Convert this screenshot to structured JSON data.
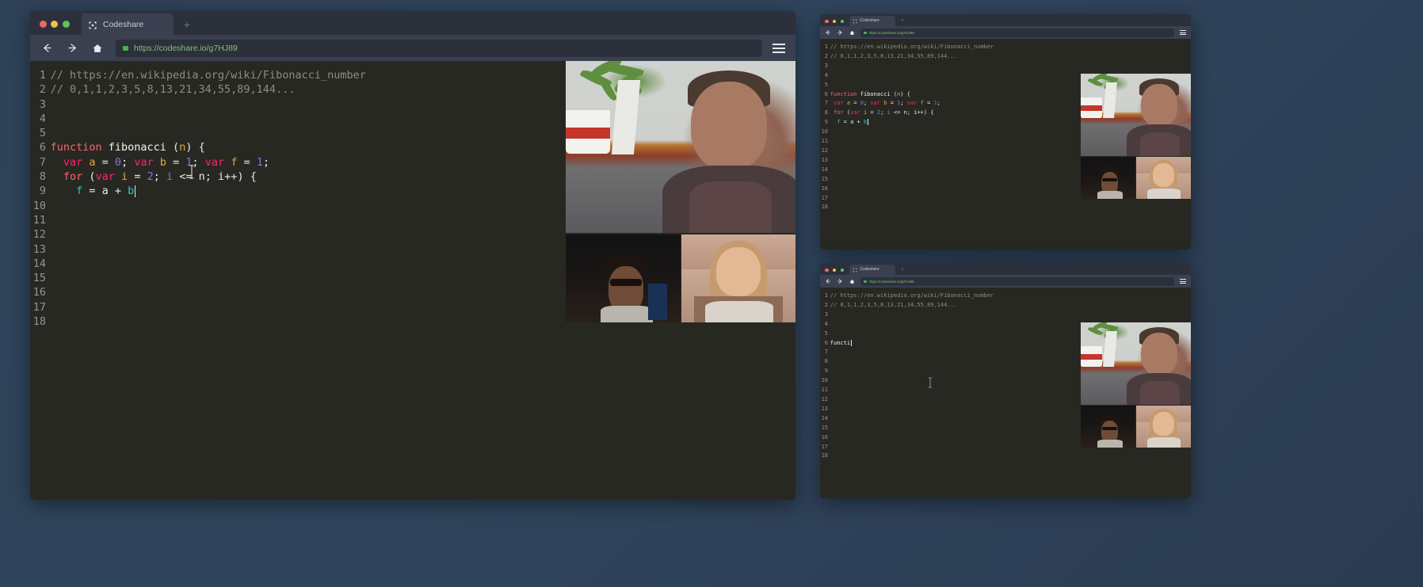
{
  "app": {
    "name": "Codeshare"
  },
  "desktop": {
    "background_color": "#2f4259"
  },
  "browser": {
    "tab_title": "Codeshare",
    "new_tab_label": "+",
    "url": "https://codeshare.io/g7HJ89",
    "lock_icon": "lock-icon",
    "back_icon": "←",
    "forward_icon": "→",
    "home_icon": "⌂",
    "menu_icon": "hamburger-menu-icon",
    "traffic_lights": [
      "close-red",
      "minimize-yellow",
      "maximize-green"
    ],
    "logo_icon": "codeshare-logo-icon"
  },
  "editor_main": {
    "line_numbers": [
      "1",
      "2",
      "3",
      "4",
      "5",
      "6",
      "7",
      "8",
      "9",
      "10",
      "11",
      "12",
      "13",
      "14",
      "15",
      "16",
      "17",
      "18"
    ],
    "lines": [
      {
        "n": "1",
        "tokens": [
          {
            "t": "// https://en.wikipedia.org/wiki/Fibonacci_number",
            "c": "com"
          }
        ]
      },
      {
        "n": "2",
        "tokens": [
          {
            "t": "// 0,1,1,2,3,5,8,13,21,34,55,89,144...",
            "c": "com"
          }
        ]
      },
      {
        "n": "3",
        "tokens": []
      },
      {
        "n": "4",
        "tokens": []
      },
      {
        "n": "5",
        "tokens": []
      },
      {
        "n": "6",
        "tokens": [
          {
            "t": "function",
            "c": "kw"
          },
          {
            "t": " ",
            "c": "pl"
          },
          {
            "t": "fibonacci",
            "c": "fn"
          },
          {
            "t": " (",
            "c": "pl"
          },
          {
            "t": "n",
            "c": "id"
          },
          {
            "t": ") {",
            "c": "pl"
          }
        ]
      },
      {
        "n": "7",
        "tokens": [
          {
            "t": "  ",
            "c": "pl"
          },
          {
            "t": "var",
            "c": "var"
          },
          {
            "t": " ",
            "c": "pl"
          },
          {
            "t": "a",
            "c": "id"
          },
          {
            "t": " = ",
            "c": "op"
          },
          {
            "t": "0",
            "c": "num"
          },
          {
            "t": "; ",
            "c": "pl"
          },
          {
            "t": "var",
            "c": "var"
          },
          {
            "t": " ",
            "c": "pl"
          },
          {
            "t": "b",
            "c": "id"
          },
          {
            "t": " = ",
            "c": "op"
          },
          {
            "t": "1",
            "c": "num"
          },
          {
            "t": "; ",
            "c": "pl"
          },
          {
            "t": "var",
            "c": "var"
          },
          {
            "t": " ",
            "c": "pl"
          },
          {
            "t": "f",
            "c": "id"
          },
          {
            "t": " = ",
            "c": "op"
          },
          {
            "t": "1",
            "c": "num"
          },
          {
            "t": ";",
            "c": "pl"
          }
        ]
      },
      {
        "n": "8",
        "tokens": [
          {
            "t": "  ",
            "c": "pl"
          },
          {
            "t": "for",
            "c": "kw"
          },
          {
            "t": " (",
            "c": "pl"
          },
          {
            "t": "var",
            "c": "var"
          },
          {
            "t": " ",
            "c": "pl"
          },
          {
            "t": "i",
            "c": "id"
          },
          {
            "t": " = ",
            "c": "op"
          },
          {
            "t": "2",
            "c": "num"
          },
          {
            "t": "; ",
            "c": "pl"
          },
          {
            "t": "i",
            "c": "num"
          },
          {
            "t": " <= ",
            "c": "op"
          },
          {
            "t": "n",
            "c": "pl"
          },
          {
            "t": "; ",
            "c": "pl"
          },
          {
            "t": "i++",
            "c": "pl"
          },
          {
            "t": ") {",
            "c": "pl"
          }
        ]
      },
      {
        "n": "9",
        "tokens": [
          {
            "t": "    ",
            "c": "pl"
          },
          {
            "t": "f",
            "c": "tl"
          },
          {
            "t": " = ",
            "c": "op"
          },
          {
            "t": "a",
            "c": "pl"
          },
          {
            "t": " + ",
            "c": "op"
          },
          {
            "t": "b",
            "c": "tl"
          }
        ],
        "caret": true
      },
      {
        "n": "10",
        "tokens": []
      },
      {
        "n": "11",
        "tokens": []
      },
      {
        "n": "12",
        "tokens": []
      },
      {
        "n": "13",
        "tokens": []
      },
      {
        "n": "14",
        "tokens": []
      },
      {
        "n": "15",
        "tokens": []
      },
      {
        "n": "16",
        "tokens": []
      },
      {
        "n": "17",
        "tokens": []
      },
      {
        "n": "18",
        "tokens": []
      }
    ]
  },
  "editor_peer_top": {
    "lines": [
      {
        "n": "1",
        "tokens": [
          {
            "t": "// https://en.wikipedia.org/wiki/Fibonacci_number",
            "c": "com"
          }
        ]
      },
      {
        "n": "2",
        "tokens": [
          {
            "t": "// 0,1,1,2,3,5,8,13,21,34,55,89,144...",
            "c": "com"
          }
        ]
      },
      {
        "n": "3",
        "tokens": []
      },
      {
        "n": "4",
        "tokens": []
      },
      {
        "n": "5",
        "tokens": []
      },
      {
        "n": "6",
        "tokens": [
          {
            "t": "function",
            "c": "kw"
          },
          {
            "t": " ",
            "c": "pl"
          },
          {
            "t": "fibonacci",
            "c": "fn"
          },
          {
            "t": " (",
            "c": "pl"
          },
          {
            "t": "n",
            "c": "id"
          },
          {
            "t": ") {",
            "c": "pl"
          }
        ]
      },
      {
        "n": "7",
        "tokens": [
          {
            "t": " ",
            "c": "pl"
          },
          {
            "t": "var",
            "c": "var"
          },
          {
            "t": " ",
            "c": "pl"
          },
          {
            "t": "a",
            "c": "id"
          },
          {
            "t": " = ",
            "c": "op"
          },
          {
            "t": "0",
            "c": "num"
          },
          {
            "t": "; ",
            "c": "pl"
          },
          {
            "t": "var",
            "c": "var"
          },
          {
            "t": " ",
            "c": "pl"
          },
          {
            "t": "b",
            "c": "id"
          },
          {
            "t": " = ",
            "c": "op"
          },
          {
            "t": "1",
            "c": "num"
          },
          {
            "t": "; ",
            "c": "pl"
          },
          {
            "t": "var",
            "c": "var"
          },
          {
            "t": " ",
            "c": "pl"
          },
          {
            "t": "f",
            "c": "id"
          },
          {
            "t": " = ",
            "c": "op"
          },
          {
            "t": "1",
            "c": "num"
          },
          {
            "t": ";",
            "c": "pl"
          }
        ]
      },
      {
        "n": "8",
        "tokens": [
          {
            "t": " ",
            "c": "pl"
          },
          {
            "t": "for",
            "c": "kw"
          },
          {
            "t": " (",
            "c": "pl"
          },
          {
            "t": "var",
            "c": "var"
          },
          {
            "t": " ",
            "c": "pl"
          },
          {
            "t": "i",
            "c": "id"
          },
          {
            "t": " = ",
            "c": "op"
          },
          {
            "t": "2",
            "c": "num"
          },
          {
            "t": "; ",
            "c": "pl"
          },
          {
            "t": "i",
            "c": "num"
          },
          {
            "t": " <= ",
            "c": "op"
          },
          {
            "t": "n",
            "c": "pl"
          },
          {
            "t": "; ",
            "c": "pl"
          },
          {
            "t": "i++",
            "c": "pl"
          },
          {
            "t": ") {",
            "c": "pl"
          }
        ]
      },
      {
        "n": "9",
        "tokens": [
          {
            "t": "  ",
            "c": "pl"
          },
          {
            "t": "f",
            "c": "tl"
          },
          {
            "t": " = ",
            "c": "op"
          },
          {
            "t": "a",
            "c": "pl"
          },
          {
            "t": " + ",
            "c": "op"
          },
          {
            "t": "b",
            "c": "tl"
          }
        ],
        "caret": true
      },
      {
        "n": "10",
        "tokens": []
      },
      {
        "n": "11",
        "tokens": []
      },
      {
        "n": "12",
        "tokens": []
      },
      {
        "n": "13",
        "tokens": []
      },
      {
        "n": "14",
        "tokens": []
      },
      {
        "n": "15",
        "tokens": []
      },
      {
        "n": "16",
        "tokens": []
      },
      {
        "n": "17",
        "tokens": []
      },
      {
        "n": "18",
        "tokens": []
      }
    ]
  },
  "editor_peer_bottom": {
    "lines": [
      {
        "n": "1",
        "tokens": [
          {
            "t": "// https://en.wikipedia.org/wiki/Fibonacci_number",
            "c": "com"
          }
        ]
      },
      {
        "n": "2",
        "tokens": [
          {
            "t": "// 0,1,1,2,3,5,8,13,21,34,55,89,144...",
            "c": "com"
          }
        ]
      },
      {
        "n": "3",
        "tokens": []
      },
      {
        "n": "4",
        "tokens": []
      },
      {
        "n": "5",
        "tokens": []
      },
      {
        "n": "6",
        "tokens": [
          {
            "t": "functi",
            "c": "fn"
          }
        ],
        "caret": true
      },
      {
        "n": "7",
        "tokens": []
      },
      {
        "n": "8",
        "tokens": []
      },
      {
        "n": "9",
        "tokens": []
      },
      {
        "n": "10",
        "tokens": []
      },
      {
        "n": "11",
        "tokens": []
      },
      {
        "n": "12",
        "tokens": []
      },
      {
        "n": "13",
        "tokens": []
      },
      {
        "n": "14",
        "tokens": []
      },
      {
        "n": "15",
        "tokens": []
      },
      {
        "n": "16",
        "tokens": []
      },
      {
        "n": "17",
        "tokens": []
      },
      {
        "n": "18",
        "tokens": []
      }
    ]
  },
  "video": {
    "participants": [
      {
        "id": "main",
        "name": "participant-main-video",
        "label": ""
      },
      {
        "id": "peer1",
        "name": "participant-peer1-video",
        "label": ""
      },
      {
        "id": "peer2",
        "name": "participant-peer2-video",
        "label": ""
      }
    ]
  },
  "colors": {
    "desktop": "#2f4259",
    "chrome": "#3a4050",
    "tabbar": "#2b303b",
    "editor_bg": "#272822",
    "url_text": "#7fc27f",
    "keyword": "#f9656c",
    "variable": "#f92672",
    "identifier": "#e8a33d",
    "number": "#8a6fdf",
    "comment": "#8a8f7f",
    "teal": "#3fbfbf"
  }
}
